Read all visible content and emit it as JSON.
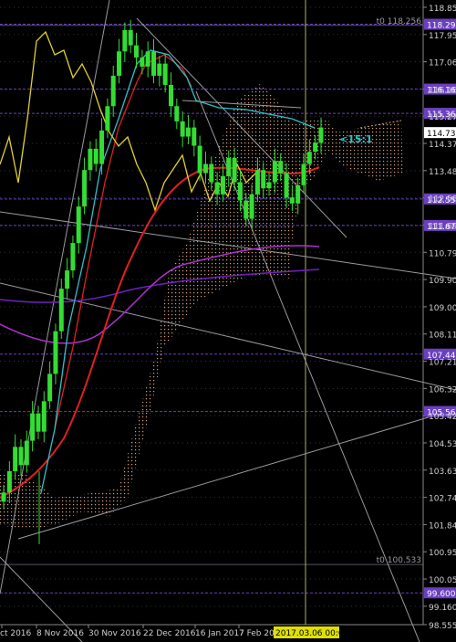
{
  "chart_data": {
    "type": "candlestick",
    "ylim": [
      98.555,
      118.85
    ],
    "y_ticks": [
      "118.85",
      "117.955",
      "117.060",
      "116.165",
      "115.270",
      "114.375",
      "113.480",
      "112.585",
      "111.690",
      "110.795",
      "109.900",
      "109.005",
      "108.110",
      "107.215",
      "106.320",
      "105.425",
      "104.530",
      "103.635",
      "102.740",
      "101.845",
      "100.950",
      "100.055",
      "99.160",
      "98.555"
    ],
    "x_labels": [
      "ct 2016",
      "8 Nov 2016",
      "30 Nov 2016",
      "22 Dec 2016",
      "16 Jan 2017",
      "7 Feb 20"
    ],
    "cursor_time_label": "2017.03.06 00:00",
    "current_price": "114.732",
    "cloud_label": "<15:1",
    "level_labels": [
      {
        "text": "t0 118.256",
        "price": 118.256,
        "style": "text"
      },
      {
        "text": "118.294",
        "price": 118.294,
        "style": "purple"
      },
      {
        "text": "116.161",
        "price": 116.161,
        "style": "purple"
      },
      {
        "text": "115.365",
        "price": 115.365,
        "style": "purple"
      },
      {
        "text": "114.732",
        "price": 114.732,
        "style": "white"
      },
      {
        "text": "112.550",
        "price": 112.55,
        "style": "purple"
      },
      {
        "text": "111.678",
        "price": 111.678,
        "style": "purple"
      },
      {
        "text": "107.449",
        "price": 107.449,
        "style": "purple"
      },
      {
        "text": "105.563",
        "price": 105.563,
        "style": "purple"
      },
      {
        "text": "t0 100.533",
        "price": 100.533,
        "style": "text"
      },
      {
        "text": "99.600",
        "price": 99.6,
        "style": "purple"
      }
    ],
    "close_series": [
      102.9,
      103.6,
      104.4,
      103.8,
      104.6,
      105.5,
      104.9,
      105.9,
      106.8,
      108.2,
      109.6,
      110.2,
      111.1,
      112.3,
      113.5,
      114.2,
      113.7,
      114.8,
      115.6,
      116.6,
      117.4,
      118.1,
      117.6,
      117.2,
      116.9,
      117.4,
      116.6,
      117.0,
      116.3,
      115.6,
      115.1,
      114.6,
      114.9,
      114.3,
      113.4,
      113.7,
      113.1,
      112.7,
      113.3,
      113.9,
      113.1,
      112.5,
      111.9,
      112.7,
      113.5,
      112.9,
      113.1,
      113.8,
      113.4,
      112.6,
      112.4,
      113.0,
      113.7,
      114.1,
      114.4,
      114.9
    ],
    "colors": {
      "candle": "#33dd33",
      "grid": "#5a5a7a",
      "purple_level": "#6a3fc0",
      "kijun": "#e02020",
      "tenkan": "#33c0c8",
      "chikou": "#e0d030",
      "sma_magenta": "#b030d0",
      "sma_purple": "#7020c0",
      "cloud": "#d4a07a",
      "axis_text": "#d0d0d0",
      "cursor": "#b0b060"
    }
  }
}
